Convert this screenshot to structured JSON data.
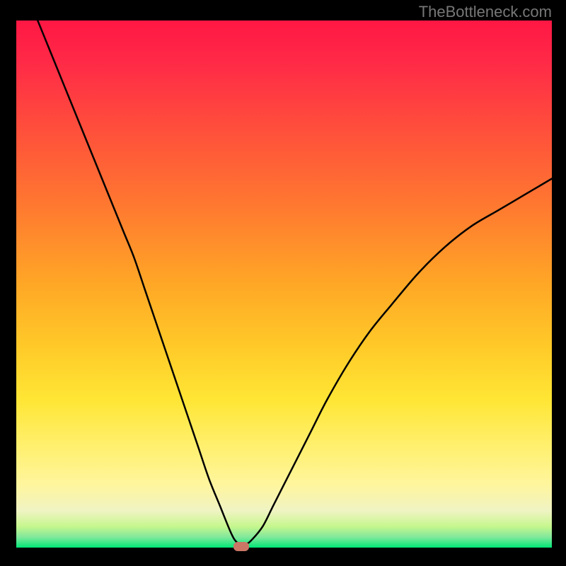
{
  "watermark": "TheBottleneck.com",
  "chart_data": {
    "type": "line",
    "title": "",
    "xlabel": "",
    "ylabel": "",
    "xlim": [
      0,
      100
    ],
    "ylim": [
      0,
      100
    ],
    "series": [
      {
        "name": "bottleneck-curve",
        "x": [
          4,
          6,
          8,
          10,
          12,
          14,
          16,
          18,
          20,
          22,
          24,
          26,
          28,
          30,
          32,
          34,
          36,
          38,
          40,
          41,
          42,
          43,
          44,
          46,
          48,
          50,
          52,
          55,
          58,
          62,
          66,
          70,
          75,
          80,
          85,
          90,
          95,
          100
        ],
        "y": [
          100,
          95,
          90,
          85,
          80,
          75,
          70,
          65,
          60,
          55,
          49,
          43,
          37,
          31,
          25,
          19,
          13,
          8,
          3,
          1.2,
          0.6,
          0.7,
          1.5,
          4,
          8,
          12,
          16,
          22,
          28,
          35,
          41,
          46,
          52,
          57,
          61,
          64,
          67,
          70
        ]
      }
    ],
    "marker_point": {
      "x": 42,
      "y": 0,
      "color": "#cc7766"
    },
    "gradient_colors": {
      "top": "#ff1744",
      "mid": "#ffca28",
      "bottom": "#00e676"
    }
  },
  "marker_label": ""
}
